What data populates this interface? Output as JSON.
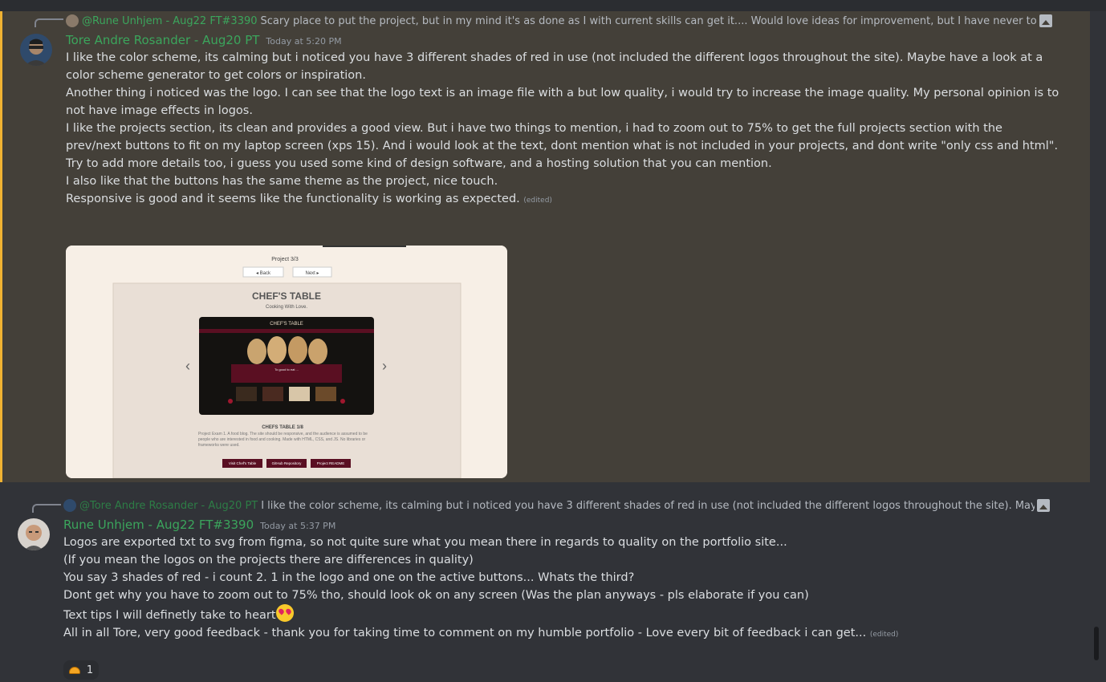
{
  "messages": [
    {
      "reply": {
        "author": "@Rune Unhjem - Aug22 FT#3390",
        "text": "Scary place to put the project, but in my mind it's as done as I with current skills can get it.... Would love ideas for improvement, but I have never touched a library or re"
      },
      "author": "Tore Andre Rosander - Aug20 PT",
      "timestamp": "Today at 5:20 PM",
      "lines": [
        "I like the color scheme, its calming but i noticed you have 3 different shades of red in use (not included the different logos throughout the site). Maybe have a look at a color scheme generator to get colors or inspiration.",
        "Another thing i noticed was the logo. I can see that the logo text is an image file with a but low quality, i would try to increase the image quality. My personal opinion is to not have image effects in logos.",
        "",
        "I like the projects section, its clean and provides a good view. But i have two things to mention, i had to zoom out to 75% to get the full projects section with the prev/next buttons to fit on my laptop screen (xps 15). And i would look at the text, dont mention what is not included in your projects, and dont write \"only css and html\". Try to add more details too, i guess you used some kind of design software, and a hosting solution that you can mention.",
        "I also like that the buttons has the same theme as the project, nice touch.",
        "",
        "Responsive is good and it seems like the functionality is working as expected."
      ],
      "edited": "(edited)",
      "attachment": {
        "project_counter": "Project 3/3",
        "back_label": "◂ Back",
        "next_label": "Next ▸",
        "title": "CHEF'S TABLE",
        "subtitle": "Cooking With Love.",
        "inner_logo": "CHEF'S TABLE",
        "inner_hero_text": "To good to eat ...",
        "caption": "CHEFS TABLE 1/8",
        "description": "Project Exam 1. A food blog. The site should be responsive, and the audience is assumed to be people who are interested in food and cooking. Made with HTML, CSS, and JS. No libraries or frameworks were used.",
        "buttons": [
          "Visit Chef's Table",
          "GitHub Repository",
          "Project README"
        ],
        "colors": {
          "accent": "#5a0f22",
          "page": "#f7efe6",
          "card": "#e9dfd6"
        }
      }
    },
    {
      "reply": {
        "author": "@Tore Andre Rosander - Aug20 PT",
        "text": "I like the color scheme, its calming but i noticed you have 3 different shades of red in use (not included the different logos throughout the site). Maybe have a look at"
      },
      "author": "Rune Unhjem - Aug22 FT#3390",
      "timestamp": "Today at 5:37 PM",
      "lines": [
        "Logos are exported txt to svg from figma, so not quite sure what you mean there in regards to quality on the portfolio site...",
        "(If you mean the logos on the projects there are differences in quality)",
        "You say 3 shades of red - i count 2. 1 in the logo and one on the active buttons... Whats the third?",
        "Dont get why you have to zoom out to 75% tho, should look ok on any screen (Was the plan anyways - pls elaborate if you can)",
        "Text tips I will definetly take to heart",
        "",
        "All in all Tore, very good feedback - thank you for taking time to comment on my humble portfolio - Love every bit of feedback i can get..."
      ],
      "edited": "(edited)",
      "reaction": {
        "emoji": "taco",
        "count": "1"
      }
    }
  ]
}
